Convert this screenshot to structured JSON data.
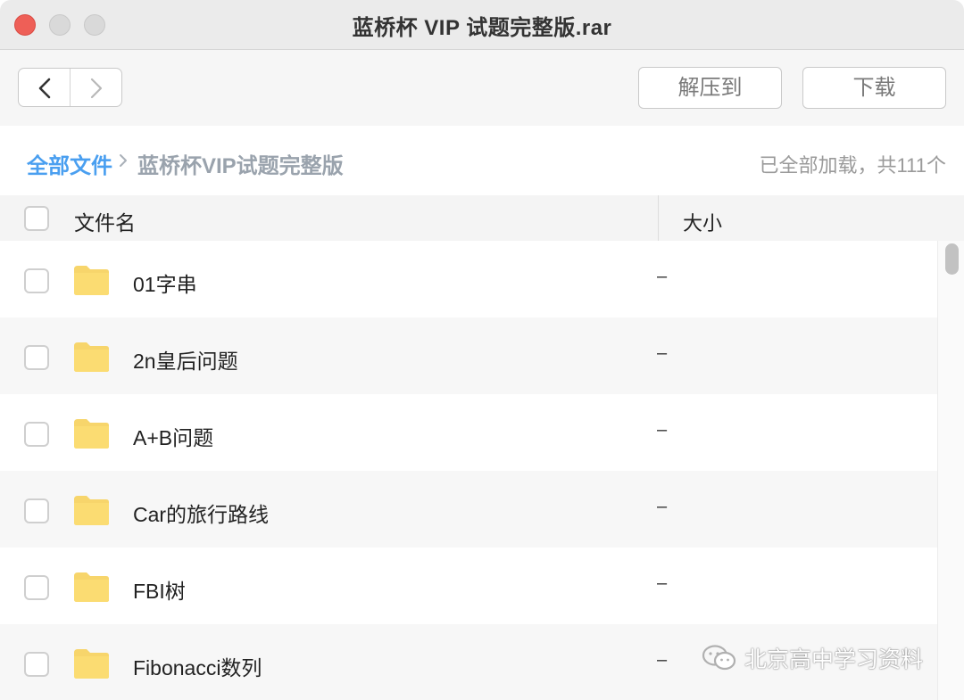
{
  "window": {
    "title": "蓝桥杯 VIP 试题完整版.rar"
  },
  "toolbar": {
    "extract_label": "解压到",
    "download_label": "下载"
  },
  "breadcrumb": {
    "root": "全部文件",
    "separator": ">",
    "current": "蓝桥杯VIP试题完整版",
    "status": "已全部加载，共111个"
  },
  "table": {
    "headers": {
      "name": "文件名",
      "size": "大小"
    },
    "rows": [
      {
        "name": "01字串",
        "size": "–",
        "icon": "folder-icon"
      },
      {
        "name": "2n皇后问题",
        "size": "–",
        "icon": "folder-icon"
      },
      {
        "name": "A+B问题",
        "size": "–",
        "icon": "folder-icon"
      },
      {
        "name": "Car的旅行路线",
        "size": "–",
        "icon": "folder-icon"
      },
      {
        "name": "FBI树",
        "size": "–",
        "icon": "folder-icon"
      },
      {
        "name": "Fibonacci数列",
        "size": "–",
        "icon": "folder-icon"
      }
    ]
  },
  "watermark": {
    "text": "北京高中学习资料",
    "icon": "wechat-icon"
  },
  "colors": {
    "accent": "#4a9ff0",
    "folder": "#f7d56b",
    "close": "#ee5f57",
    "row_alt": "#f7f7f7"
  }
}
